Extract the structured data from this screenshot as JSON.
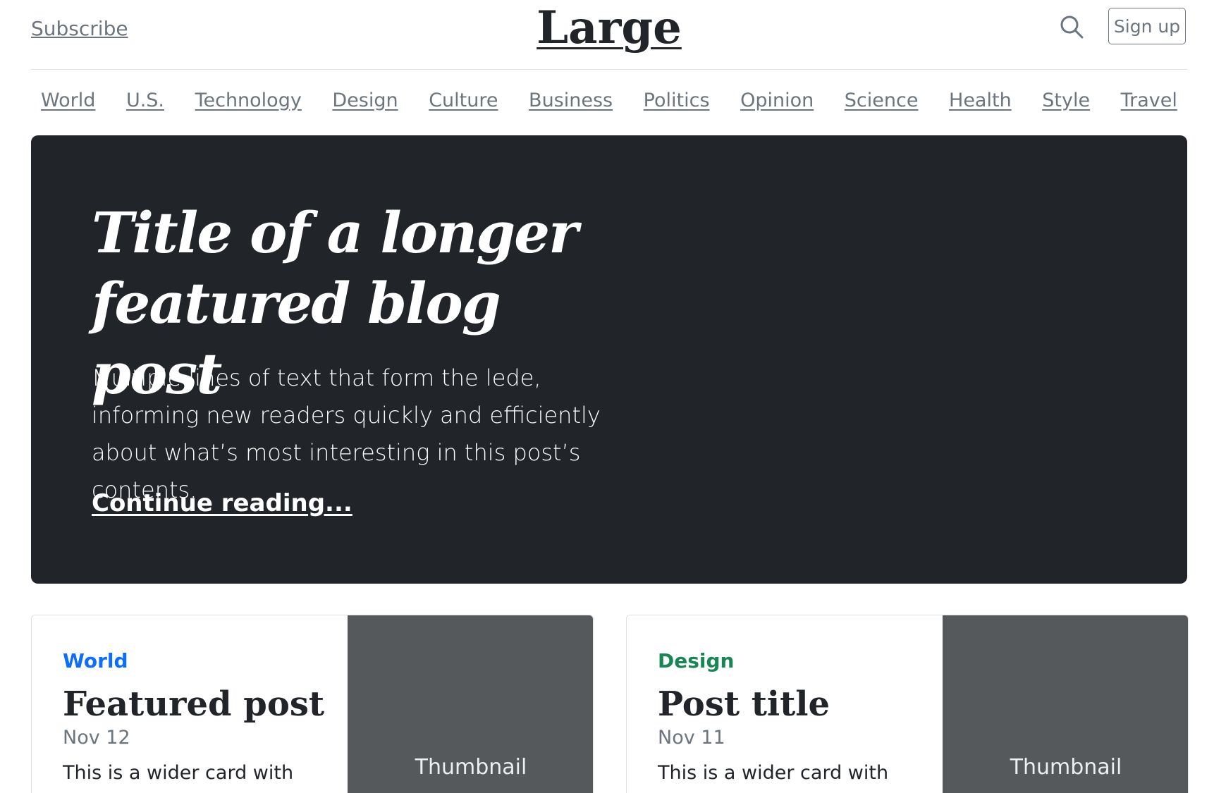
{
  "header": {
    "subscribe_label": "Subscribe",
    "brand": "Large",
    "search_icon": "search-icon",
    "signup_label": "Sign up"
  },
  "nav": {
    "items": [
      "World",
      "U.S.",
      "Technology",
      "Design",
      "Culture",
      "Business",
      "Politics",
      "Opinion",
      "Science",
      "Health",
      "Style",
      "Travel"
    ]
  },
  "hero": {
    "title_line1": "Title of a longer",
    "title_line2": "featured blog post",
    "lede": "Multiple lines of text that form the lede, informing new readers quickly and efficiently about what’s most interesting in this post’s contents.",
    "link_label": "Continue reading..."
  },
  "cards": [
    {
      "category": "World",
      "category_color": "#0d6efd",
      "title": "Featured post",
      "date": "Nov 12",
      "text": "This is a wider card with",
      "thumb_label": "Thumbnail"
    },
    {
      "category": "Design",
      "category_color": "#198754",
      "title": "Post title",
      "date": "Nov 11",
      "text": "This is a wider card with",
      "thumb_label": "Thumbnail"
    }
  ],
  "colors": {
    "hero_bg": "#212529",
    "thumb_bg": "#55595c",
    "muted": "#6c757d"
  }
}
